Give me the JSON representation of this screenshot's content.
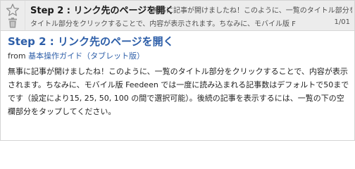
{
  "header": {
    "title": "Step 2 : リンク先のページを開く",
    "snippet_line1": "無事に記事が開けましたね！このように、一覧のタイトル部分をクリックすることで、内容が表示されます。",
    "snippet_line2": "タイトル部分をクリックすることで、内容が表示されます。ちなみに、モバイル版 F",
    "count": "1/01"
  },
  "article": {
    "title": "Step 2 : リンク先のページを開く",
    "from_prefix": "from",
    "source_link": "基本操作ガイド（タブレット版）",
    "body": "無事に記事が開けましたね！このように、一覧のタイトル部分をクリックすることで、内容が表示されます。ちなみに、モバイル版 Feedeen では一度に読み込まれる記事数はデフォルトで50までです（設定により15, 25, 50, 100 の間で選択可能）。後続の記事を表示するには、一覧の下の空欄部分をタップしてください。"
  },
  "icons": {
    "star": "star-icon",
    "trash": "trash-icon"
  },
  "colors": {
    "header_bg": "#ececec",
    "title_blue": "#2d5ea8"
  }
}
